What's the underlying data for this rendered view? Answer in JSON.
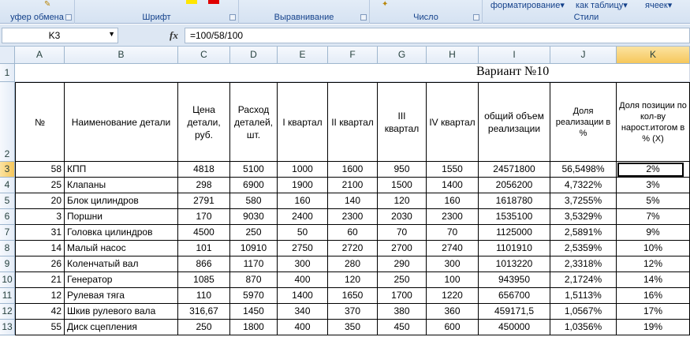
{
  "ribbon": {
    "groups": [
      {
        "label": "уфер обмена"
      },
      {
        "label": "Шрифт"
      },
      {
        "label": "Выравнивание"
      },
      {
        "label": "Число"
      },
      {
        "label": "Стили"
      }
    ],
    "top_items": [
      "форматирование",
      "как таблицу",
      "ячеек"
    ],
    "dropdown_glyph": "▾"
  },
  "formula_bar": {
    "name_box": "K3",
    "fx_label": "fx",
    "formula": "=100/58/100"
  },
  "columns": [
    "A",
    "B",
    "C",
    "D",
    "E",
    "F",
    "G",
    "H",
    "I",
    "J",
    "K"
  ],
  "rows": [
    "1",
    "2",
    "3",
    "4",
    "5",
    "6",
    "7",
    "8",
    "9",
    "10",
    "11",
    "12",
    "13"
  ],
  "title": "Вариант №10",
  "headers": [
    "№",
    "Наименование детали",
    "Цена детали, руб.",
    "Расход деталей, шт.",
    "I квартал",
    "II квартал",
    "III квартал",
    "IV квартал",
    "общий объем реализации",
    "Доля реализации в %",
    "Доля позиции по кол-ву нарост.итогом в % (X)"
  ],
  "table": [
    [
      "58",
      "КПП",
      "4818",
      "5100",
      "1000",
      "1600",
      "950",
      "1550",
      "24571800",
      "56,5498%",
      "2%"
    ],
    [
      "25",
      "Клапаны",
      "298",
      "6900",
      "1900",
      "2100",
      "1500",
      "1400",
      "2056200",
      "4,7322%",
      "3%"
    ],
    [
      "20",
      "Блок цилиндров",
      "2791",
      "580",
      "160",
      "140",
      "120",
      "160",
      "1618780",
      "3,7255%",
      "5%"
    ],
    [
      "3",
      "Поршни",
      "170",
      "9030",
      "2400",
      "2300",
      "2030",
      "2300",
      "1535100",
      "3,5329%",
      "7%"
    ],
    [
      "31",
      "Головка цилиндров",
      "4500",
      "250",
      "50",
      "60",
      "70",
      "70",
      "1125000",
      "2,5891%",
      "9%"
    ],
    [
      "14",
      "Малый насос",
      "101",
      "10910",
      "2750",
      "2720",
      "2700",
      "2740",
      "1101910",
      "2,5359%",
      "10%"
    ],
    [
      "26",
      "Коленчатый вал",
      "866",
      "1170",
      "300",
      "280",
      "290",
      "300",
      "1013220",
      "2,3318%",
      "12%"
    ],
    [
      "21",
      "Генератор",
      "1085",
      "870",
      "400",
      "120",
      "250",
      "100",
      "943950",
      "2,1724%",
      "14%"
    ],
    [
      "12",
      "Рулевая тяга",
      "110",
      "5970",
      "1400",
      "1650",
      "1700",
      "1220",
      "656700",
      "1,5113%",
      "16%"
    ],
    [
      "42",
      "Шкив рулевого вала",
      "316,67",
      "1450",
      "340",
      "370",
      "380",
      "360",
      "459171,5",
      "1,0567%",
      "17%"
    ],
    [
      "55",
      "Диск сцепления",
      "250",
      "1800",
      "400",
      "350",
      "450",
      "600",
      "450000",
      "1,0356%",
      "19%"
    ]
  ],
  "colors": {
    "selected_header": "#f6c75b",
    "ribbon_text": "#15428b"
  }
}
